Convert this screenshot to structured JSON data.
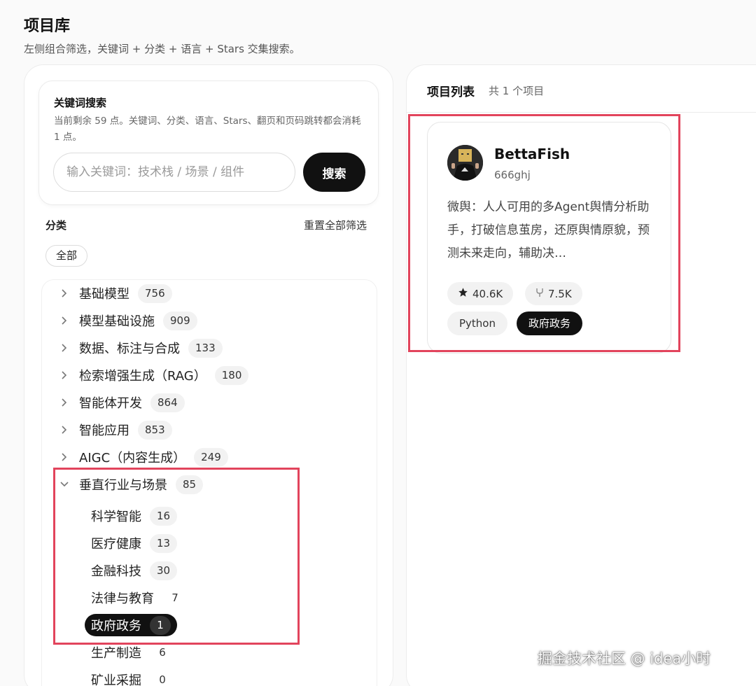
{
  "page": {
    "title": "项目库",
    "subtitle": "左侧组合筛选，关键词 + 分类 + 语言 + Stars 交集搜索。"
  },
  "search": {
    "title": "关键词搜索",
    "hint": "当前剩余 59 点。关键词、分类、语言、Stars、翻页和页码跳转都会消耗 1 点。",
    "placeholder": "输入关键词：技术栈 / 场景 / 组件",
    "button_label": "搜索"
  },
  "filters": {
    "category_label": "分类",
    "reset_label": "重置全部筛选",
    "all_chip": "全部",
    "categories": [
      {
        "label": "基础模型",
        "count": "756",
        "expanded": false
      },
      {
        "label": "模型基础设施",
        "count": "909",
        "expanded": false
      },
      {
        "label": "数据、标注与合成",
        "count": "133",
        "expanded": false
      },
      {
        "label": "检索增强生成（RAG）",
        "count": "180",
        "expanded": false
      },
      {
        "label": "智能体开发",
        "count": "864",
        "expanded": false
      },
      {
        "label": "智能应用",
        "count": "853",
        "expanded": false
      },
      {
        "label": "AIGC（内容生成）",
        "count": "249",
        "expanded": false
      },
      {
        "label": "垂直行业与场景",
        "count": "85",
        "expanded": true
      }
    ],
    "subcategories": [
      {
        "label": "科学智能",
        "count": "16"
      },
      {
        "label": "医疗健康",
        "count": "13"
      },
      {
        "label": "金融科技",
        "count": "30"
      },
      {
        "label": "法律与教育",
        "count": "7"
      },
      {
        "label": "政府政务",
        "count": "1",
        "selected": true
      },
      {
        "label": "生产制造",
        "count": "6"
      },
      {
        "label": "矿业采掘",
        "count": "0"
      }
    ]
  },
  "results": {
    "title": "项目列表",
    "count_text": "共 1 个项目",
    "projects": [
      {
        "name": "BettaFish",
        "owner": "666ghj",
        "description": "微舆：人人可用的多Agent舆情分析助手，打破信息茧房，还原舆情原貌，预测未来走向，辅助决…",
        "stars": "40.6K",
        "forks": "7.5K",
        "language": "Python",
        "category": "政府政务"
      }
    ]
  },
  "watermark": "掘金技术社区 @ idea小时",
  "colors": {
    "accent": "#111111",
    "highlight": "#e2445c",
    "chip_bg": "#f2f2f2"
  },
  "icons": {
    "star": "star-icon",
    "fork": "fork-icon",
    "chevron_right": "chevron-right-icon",
    "chevron_down": "chevron-down-icon"
  }
}
